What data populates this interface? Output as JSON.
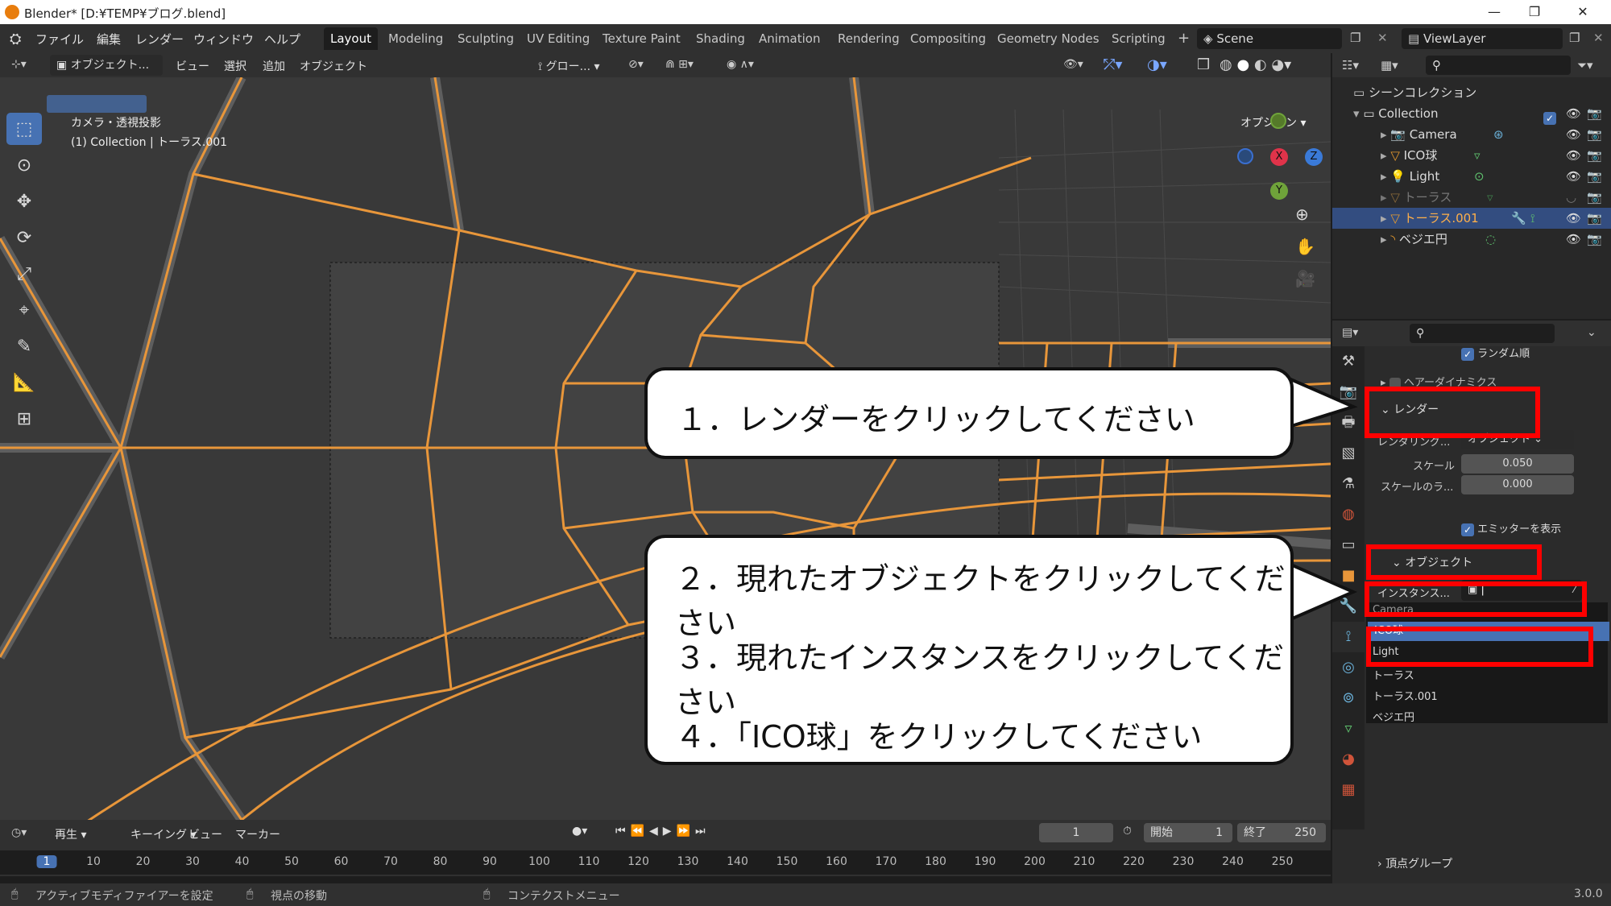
{
  "window": {
    "title": "Blender* [D:¥TEMP¥ブログ.blend]",
    "minimize": "—",
    "maximize": "❐",
    "close": "✕"
  },
  "menus": [
    "ファイル",
    "編集",
    "レンダー",
    "ウィンドウ",
    "ヘルプ"
  ],
  "workspaces": [
    "Layout",
    "Modeling",
    "Sculpting",
    "UV Editing",
    "Texture Paint",
    "Shading",
    "Animation",
    "Rendering",
    "Compositing",
    "Geometry Nodes",
    "Scripting"
  ],
  "active_workspace": "Layout",
  "scene": "Scene",
  "view_layer": "ViewLayer",
  "viewport_header": {
    "mode": "オブジェクト...",
    "items": [
      "ビュー",
      "選択",
      "追加",
      "オブジェクト"
    ],
    "transform": "グロー...",
    "options": "オプション"
  },
  "viewport": {
    "camera_label": "カメラ・透視投影",
    "collection_label": "(1) Collection | トーラス.001",
    "gizmo": {
      "x": "X",
      "y": "Y",
      "z": "Z"
    }
  },
  "outliner": {
    "root": "シーンコレクション",
    "collection": "Collection",
    "items": [
      {
        "name": "Camera",
        "icon": "camera-icon"
      },
      {
        "name": "ICO球",
        "icon": "mesh-icon"
      },
      {
        "name": "Light",
        "icon": "light-icon"
      },
      {
        "name": "トーラス",
        "icon": "mesh-icon"
      },
      {
        "name": "トーラス.001",
        "icon": "mesh-icon",
        "selected": true
      },
      {
        "name": "ベジエ円",
        "icon": "curve-icon"
      }
    ]
  },
  "properties": {
    "random_order": "ランダム順",
    "hair_dynamics": "ヘアーダイナミクス",
    "render_section": "レンダー",
    "render_as_label": "レンダリング...",
    "render_as_value": "オブジェクト",
    "scale_label": "スケール",
    "scale_value": "0.050",
    "scale_random_label": "スケールのラ...",
    "scale_random_value": "0.000",
    "show_emitter": "エミッターを表示",
    "object_section": "オブジェクト",
    "instance_label": "インスタンス...",
    "dropdown_options": [
      "Camera",
      "ICO球",
      "Light",
      "トーラス",
      "トーラス.001",
      "ベジエ円"
    ],
    "dropdown_selected": "ICO球",
    "vertex_groups": "頂点グループ"
  },
  "instructions": {
    "step1": "１．レンダーをクリックしてください",
    "step2": "２．現れたオブジェクトをクリックしてください",
    "step3": "３．現れたインスタンスをクリックしてください",
    "step4": "４．「ICO球」をクリックしてください"
  },
  "timeline": {
    "playback": "再生",
    "keying": "キーイング",
    "view": "ビュー",
    "marker": "マーカー",
    "current_frame": "1",
    "start_label": "開始",
    "start": "1",
    "end_label": "終了",
    "end": "250",
    "ticks": [
      "1",
      "10",
      "20",
      "30",
      "40",
      "50",
      "60",
      "70",
      "80",
      "90",
      "100",
      "110",
      "120",
      "130",
      "140",
      "150",
      "160",
      "170",
      "180",
      "190",
      "200",
      "210",
      "220",
      "230",
      "240",
      "250"
    ]
  },
  "statusbar": {
    "left": "アクティブモディファイアーを設定",
    "middle": "視点の移動",
    "right": "コンテクストメニュー",
    "version": "3.0.0"
  }
}
